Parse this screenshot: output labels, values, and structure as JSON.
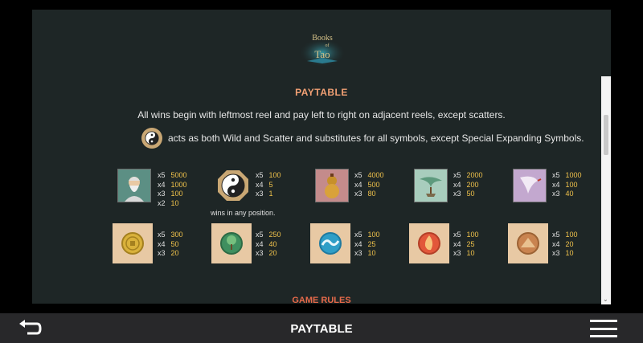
{
  "game": {
    "logo_text": [
      "Books",
      "of",
      "Tao"
    ],
    "heading": "PAYTABLE",
    "intro": "All wins begin with leftmost reel and pay left to right on adjacent reels, except scatters.",
    "wild_text": "acts as both Wild and Scatter and substitutes for all symbols, except Special Expanding Symbols.",
    "next_section": "GAME RULES",
    "scatter_note": "wins in any position."
  },
  "symbols": [
    {
      "icon": "sage-icon",
      "pays": [
        [
          "x5",
          "5000"
        ],
        [
          "x4",
          "1000"
        ],
        [
          "x3",
          "100"
        ],
        [
          "x2",
          "10"
        ]
      ]
    },
    {
      "icon": "yin-yang-icon",
      "pays": [
        [
          "x5",
          "100"
        ],
        [
          "x4",
          "5"
        ],
        [
          "x3",
          "1"
        ]
      ]
    },
    {
      "icon": "gourd-icon",
      "pays": [
        [
          "x5",
          "4000"
        ],
        [
          "x4",
          "500"
        ],
        [
          "x3",
          "80"
        ]
      ]
    },
    {
      "icon": "bonsai-icon",
      "pays": [
        [
          "x5",
          "2000"
        ],
        [
          "x4",
          "200"
        ],
        [
          "x3",
          "50"
        ]
      ]
    },
    {
      "icon": "crane-icon",
      "pays": [
        [
          "x5",
          "1000"
        ],
        [
          "x4",
          "100"
        ],
        [
          "x3",
          "40"
        ]
      ]
    },
    {
      "icon": "gold-coin-icon",
      "pays": [
        [
          "x5",
          "300"
        ],
        [
          "x4",
          "50"
        ],
        [
          "x3",
          "20"
        ]
      ]
    },
    {
      "icon": "tree-icon",
      "pays": [
        [
          "x5",
          "250"
        ],
        [
          "x4",
          "40"
        ],
        [
          "x3",
          "20"
        ]
      ]
    },
    {
      "icon": "water-icon",
      "pays": [
        [
          "x5",
          "100"
        ],
        [
          "x4",
          "25"
        ],
        [
          "x3",
          "10"
        ]
      ]
    },
    {
      "icon": "fire-icon",
      "pays": [
        [
          "x5",
          "100"
        ],
        [
          "x4",
          "25"
        ],
        [
          "x3",
          "10"
        ]
      ]
    },
    {
      "icon": "earth-icon",
      "pays": [
        [
          "x5",
          "100"
        ],
        [
          "x4",
          "20"
        ],
        [
          "x3",
          "10"
        ]
      ]
    }
  ],
  "bottom_bar": {
    "title": "PAYTABLE",
    "back_icon": "back-arrow-icon",
    "menu_icon": "hamburger-menu-icon"
  },
  "colors": {
    "heading": "#f2a074",
    "value": "#f0c24b",
    "panel": "#1e2626",
    "bar": "#28282a"
  }
}
